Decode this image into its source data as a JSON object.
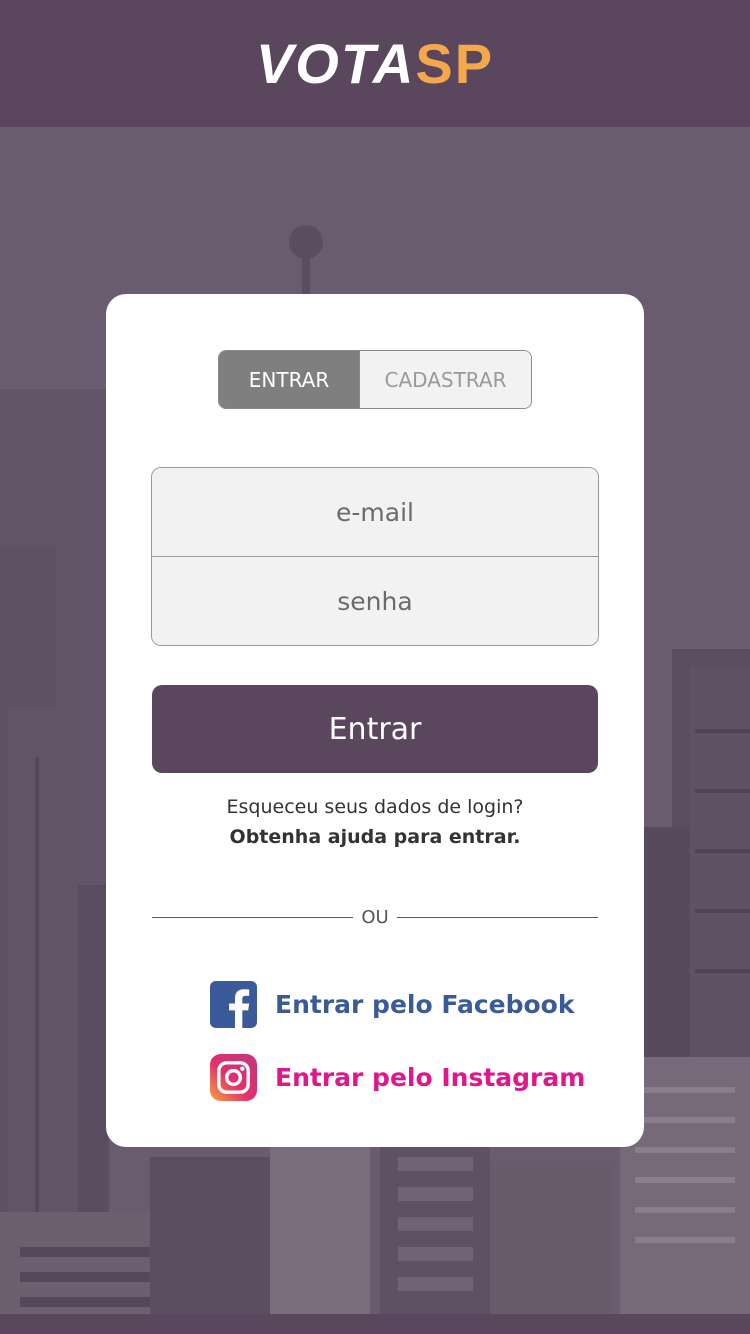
{
  "header": {
    "logo_part1": "VOTA",
    "logo_part2": "SP"
  },
  "tabs": [
    {
      "label": "ENTRAR"
    },
    {
      "label": "CADASTRAR"
    }
  ],
  "form": {
    "email_placeholder": "e-mail",
    "password_placeholder": "senha"
  },
  "login_button": "Entrar",
  "help": {
    "question": "Esqueceu seus dados de login?",
    "link": "Obtenha ajuda para entrar."
  },
  "divider": "OU",
  "social": {
    "facebook_label": "Entrar pelo Facebook",
    "instagram_label": "Entrar pelo Instagram"
  },
  "colors": {
    "header_bg": "#5a475d",
    "logo_accent": "#f5a84b",
    "primary_button": "#5a475d",
    "facebook": "#3b5a9a",
    "instagram": "#e0168f"
  },
  "icons": [
    "facebook-icon",
    "instagram-icon"
  ]
}
